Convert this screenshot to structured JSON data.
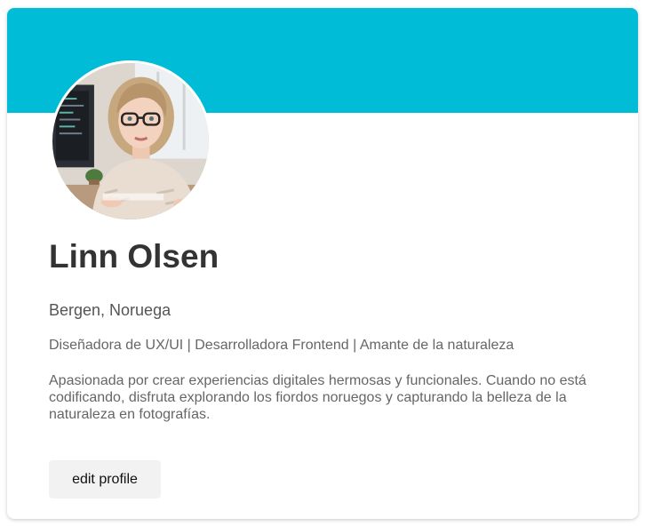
{
  "profile": {
    "name": "Linn Olsen",
    "location": "Bergen, Noruega",
    "headline": "Diseñadora de UX/UI | Desarrolladora Frontend | Amante de la naturaleza",
    "bio": "Apasionada por crear experiencias digitales hermosas y funcionales. Cuando no está codificando, disfruta explorando los fiordos noruegos y capturando la belleza de la naturaleza en fotografías.",
    "edit_button_label": "edit profile",
    "avatar_alt": "avatar"
  },
  "colors": {
    "cover": "#00bcd6",
    "name_text": "#333333",
    "body_text": "#666666",
    "button_bg": "#f2f2f2"
  }
}
